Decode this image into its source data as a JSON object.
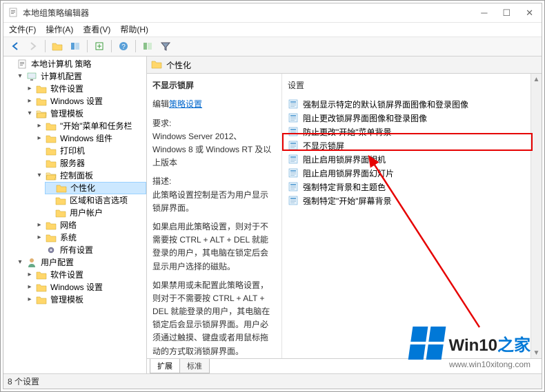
{
  "title": "本地组策略编辑器",
  "menus": [
    "文件(F)",
    "操作(A)",
    "查看(V)",
    "帮助(H)"
  ],
  "toolbar_icons": [
    "back-icon",
    "forward-icon",
    "up-icon",
    "show-icon",
    "export-icon",
    "refresh-icon",
    "help-icon",
    "props-icon",
    "filter-icon"
  ],
  "tree": {
    "root": "本地计算机 策略",
    "computer_config": "计算机配置",
    "software_settings": "软件设置",
    "windows_settings": "Windows 设置",
    "admin_templates": "管理模板",
    "start_taskbar": "\"开始\"菜单和任务栏",
    "windows_components": "Windows 组件",
    "printers": "打印机",
    "servers": "服务器",
    "control_panel": "控制面板",
    "personalization": "个性化",
    "region_language": "区域和语言选项",
    "user_accounts": "用户帐户",
    "network": "网络",
    "system": "系统",
    "all_settings": "所有设置",
    "user_config": "用户配置",
    "u_software_settings": "软件设置",
    "u_windows_settings": "Windows 设置",
    "u_admin_templates": "管理模板"
  },
  "path_header": "个性化",
  "desc": {
    "title": "不显示锁屏",
    "edit_link_prefix": "编辑",
    "edit_link": "策略设置",
    "req_label": "要求:",
    "req_text": "Windows Server 2012、Windows 8 或 Windows RT 及以上版本",
    "desc_label": "描述:",
    "desc_text": "此策略设置控制是否为用户显示锁屏界面。",
    "para2": "如果启用此策略设置，则对于不需要按 CTRL + ALT + DEL 就能登录的用户，其电脑在锁定后会显示用户选择的磁贴。",
    "para3": "如果禁用或未配置此策略设置，则对于不需要按 CTRL + ALT + DEL 就能登录的用户，其电脑在锁定后会显示锁屏界面。用户必须通过触摸、键盘或者用鼠标拖动的方式取消锁屏界面。"
  },
  "settings_header": "设置",
  "settings": [
    "强制显示特定的默认锁屏界面图像和登录图像",
    "阻止更改锁屏界面图像和登录图像",
    "防止更改\"开始\"菜单背景",
    "不显示锁屏",
    "阻止启用锁屏界面相机",
    "阻止启用锁屏界面幻灯片",
    "强制特定背景和主题色",
    "强制特定\"开始\"屏幕背景"
  ],
  "tabs": {
    "extended": "扩展",
    "standard": "标准"
  },
  "status": "8 个设置",
  "watermark": {
    "brand_a": "Win10",
    "brand_b": "之家",
    "url": "www.win10xitong.com"
  }
}
